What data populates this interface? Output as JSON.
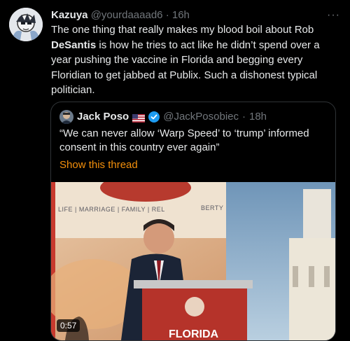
{
  "tweet": {
    "name": "Kazuya",
    "handle": "@yourdaaaad6",
    "dot": "·",
    "time": "16h",
    "more": "···",
    "text_part1": "The one thing that really makes my blood boil about Rob ",
    "text_bold": "DeSantis",
    "text_part2": " is how he tries to act like he didn’t spend over a year pushing the vaccine in Florida and begging every Floridian to get jabbed at Publix. Such a dishonest typical politician."
  },
  "quote": {
    "name": "Jack Poso",
    "flag": "flag-us-icon",
    "verified": "verified-badge-icon",
    "handle": "@JackPosobiec",
    "dot": "·",
    "time": "18h",
    "text": "“We can never allow ‘Warp Speed’ to ‘trump’ informed consent in this country ever again”",
    "show_thread": "Show this thread",
    "media": {
      "banner_text": "LIFE | MARRIAGE | FAMILY | REL",
      "banner_text_end": "BERTY",
      "podium_text": "FLORIDA",
      "duration": "0:57"
    }
  },
  "colors": {
    "background": "#000000",
    "text": "#e7e9ea",
    "muted": "#71767b",
    "link": "#f4900c",
    "verified": "#1d9bf0",
    "border": "#2f3336"
  }
}
